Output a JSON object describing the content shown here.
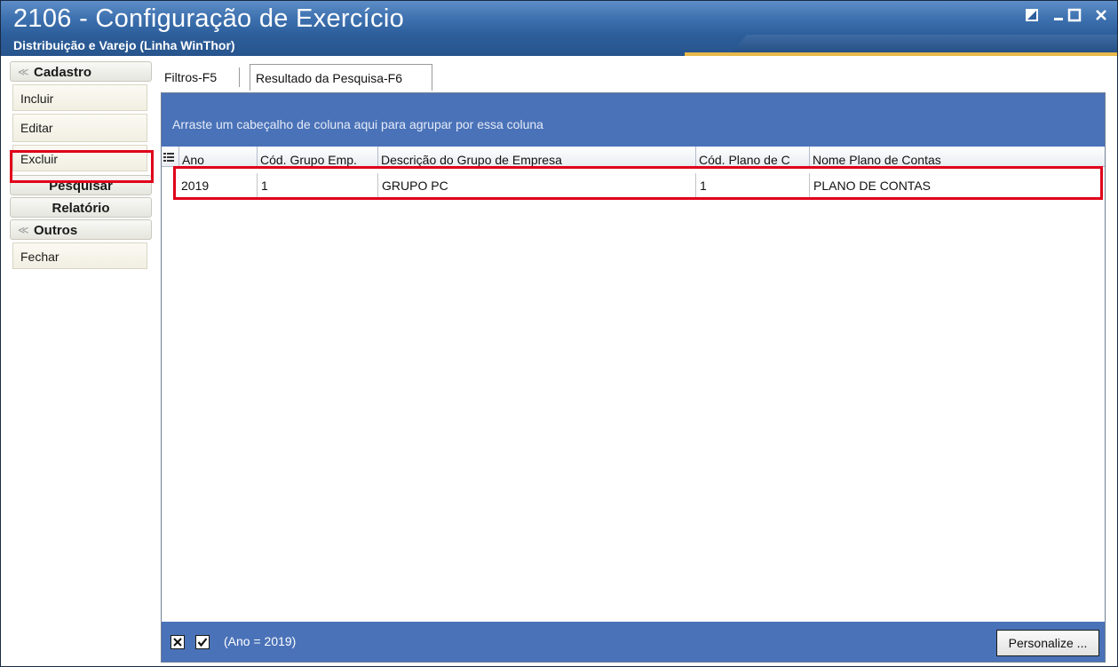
{
  "window": {
    "title": "2106 - Configuração de Exercício",
    "subtitle": "Distribuição e Varejo (Linha WinThor)",
    "controls": [
      "restore-icon",
      "minimize-icon",
      "maximize-icon",
      "close-icon"
    ]
  },
  "sidebar": {
    "cadastro": {
      "label": "Cadastro",
      "items": [
        "Incluir",
        "Editar",
        "Excluir"
      ]
    },
    "pesquisar": "Pesquisar",
    "relatorio": "Relatório",
    "outros": {
      "label": "Outros",
      "items": [
        "Fechar"
      ]
    }
  },
  "tabs": [
    "Filtros-F5",
    "Resultado da Pesquisa-F6"
  ],
  "grid": {
    "group_hint": "Arraste um cabeçalho de coluna aqui para agrupar por essa coluna",
    "columns": [
      "Ano",
      "Cód. Grupo Emp.",
      "Descrição do Grupo de Empresa",
      "Cód. Plano de C",
      "Nome Plano de Contas"
    ],
    "rows": [
      [
        "2019",
        "1",
        "GRUPO PC",
        "1",
        "PLANO DE CONTAS"
      ]
    ]
  },
  "filter": {
    "text": "(Ano = 2019)",
    "personalize": "Personalize ..."
  },
  "colors": {
    "title_bar": "#2d5f9c",
    "grid_band": "#4a72b8",
    "highlight": "#e0001a"
  }
}
